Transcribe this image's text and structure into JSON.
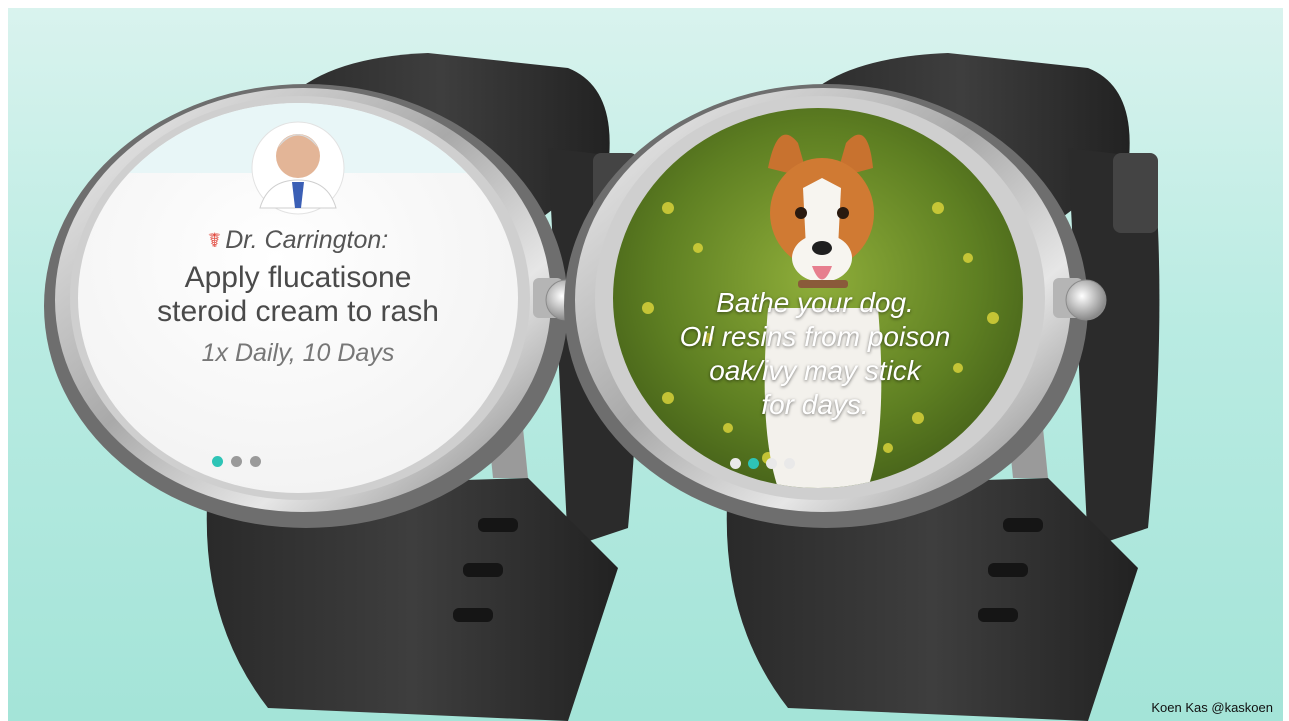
{
  "watch_left": {
    "sender": "Dr. Carrington:",
    "sender_icon": "caduceus-icon",
    "message_line1": "Apply flucatisone",
    "message_line2": "steroid cream to rash",
    "dosage": "1x Daily, 10 Days",
    "page_dots": {
      "count": 3,
      "active": 0
    },
    "accent": "#2ec4b6"
  },
  "watch_right": {
    "line1": "Bathe your dog.",
    "line2": "Oil resins from poison",
    "line3": "oak/ivy may stick",
    "line4": "for days.",
    "page_dots": {
      "count": 4,
      "active": 1
    },
    "accent": "#2ec4b6"
  },
  "credit": "Koen Kas @kaskoen"
}
